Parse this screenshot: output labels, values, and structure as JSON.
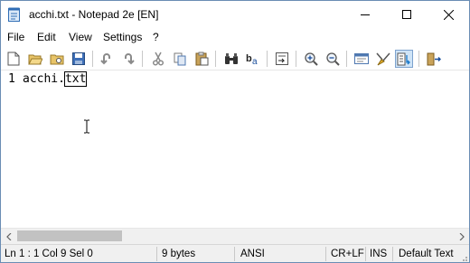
{
  "window": {
    "title": "acchi.txt - Notepad 2e [EN]"
  },
  "menu": {
    "file": "File",
    "edit": "Edit",
    "view": "View",
    "settings": "Settings",
    "help": "?"
  },
  "editor": {
    "line_number": "1",
    "text_before": "acchi.",
    "text_selected": "txt"
  },
  "status": {
    "position": "Ln 1 : 1   Col 9   Sel 0",
    "size": "9 bytes",
    "encoding": "ANSI",
    "line_ending": "CR+LF",
    "insert_mode": "INS",
    "scheme": "Default Text"
  },
  "colors": {
    "accent": "#1979ca",
    "toolbar_active": "#cfe4f7",
    "statusbar": "#f0f0f0"
  }
}
